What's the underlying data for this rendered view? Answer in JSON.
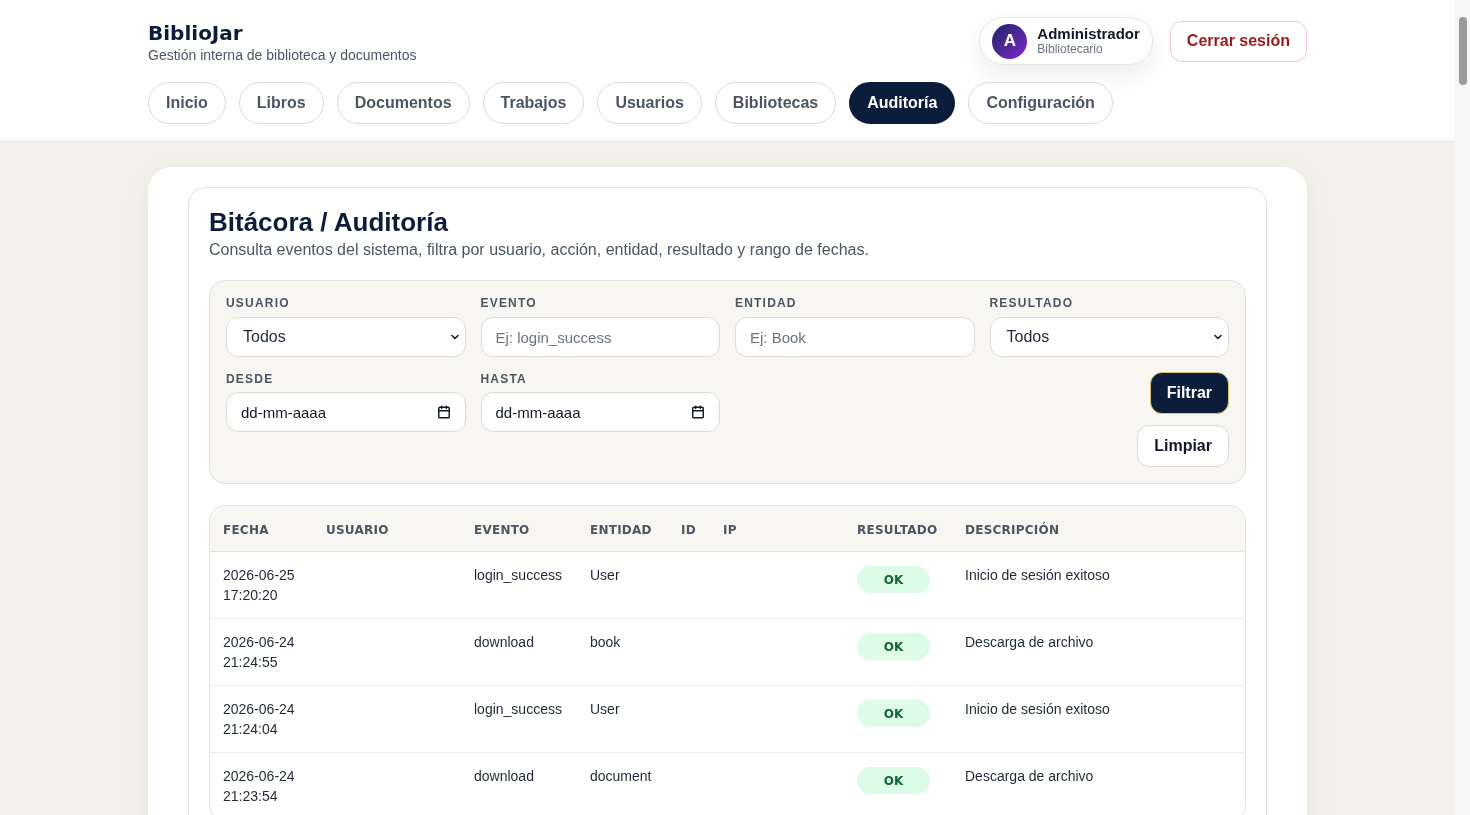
{
  "header": {
    "brand": "BiblioJar",
    "tagline": "Gestión interna de biblioteca y documentos",
    "user": {
      "initial": "A",
      "name": "Administrador",
      "role": "Bibliotecario"
    },
    "logout_button": "Cerrar sesión"
  },
  "nav": [
    {
      "label": "Inicio",
      "selected": false
    },
    {
      "label": "Libros",
      "selected": false
    },
    {
      "label": "Documentos",
      "selected": false
    },
    {
      "label": "Trabajos",
      "selected": false
    },
    {
      "label": "Usuarios",
      "selected": false
    },
    {
      "label": "Bibliotecas",
      "selected": false
    },
    {
      "label": "Auditoría",
      "selected": true
    },
    {
      "label": "Configuración",
      "selected": false
    }
  ],
  "audit": {
    "title": "Bitácora / Auditoría",
    "subtitle": "Consulta eventos del sistema, filtra por usuario, acción, entidad, resultado y rango de fechas.",
    "filters": [
      {
        "label": "USUARIO",
        "kind": "select",
        "value": "Todos"
      },
      {
        "label": "EVENTO",
        "kind": "text",
        "placeholder": "Ej: login_success"
      },
      {
        "label": "ENTIDAD",
        "kind": "text",
        "placeholder": "Ej: Book"
      },
      {
        "label": "RESULTADO",
        "kind": "select",
        "value": "Todos"
      },
      {
        "label": "DESDE",
        "kind": "date",
        "placeholder": "dd-mm-aaaa"
      },
      {
        "label": "HASTA",
        "kind": "date",
        "placeholder": "dd-mm-aaaa"
      }
    ],
    "buttons": [
      {
        "label": "Filtrar",
        "kind": "primary"
      },
      {
        "label": "Limpiar",
        "kind": "secondary"
      }
    ],
    "table": {
      "columns": [
        "FECHA",
        "USUARIO",
        "EVENTO",
        "ENTIDAD",
        "ID",
        "IP",
        "RESULTADO",
        "DESCRIPCIÓN"
      ],
      "rows": [
        {
          "date": "2026-06-25 17:20:20",
          "event": "login_success",
          "entity": "User",
          "result": "OK",
          "description": "Inicio de sesión exitoso"
        },
        {
          "date": "2026-06-24 21:24:55",
          "event": "download",
          "entity": "book",
          "result": "OK",
          "description": "Descarga de archivo"
        },
        {
          "date": "2026-06-24 21:24:04",
          "event": "login_success",
          "entity": "User",
          "result": "OK",
          "description": "Inicio de sesión exitoso"
        },
        {
          "date": "2026-06-24 21:23:54",
          "event": "download",
          "entity": "document",
          "result": "OK",
          "description": "Descarga de archivo"
        }
      ]
    }
  }
}
